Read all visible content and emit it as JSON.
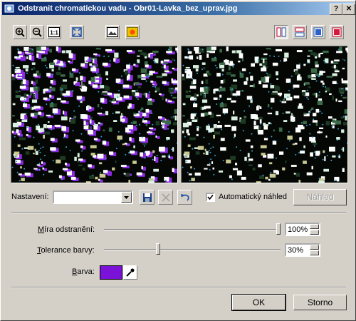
{
  "window": {
    "title": "Odstranit chromatickou vadu - Obr01-Lavka_bez_uprav.jpg",
    "help_label": "?",
    "close_label": "✕"
  },
  "toolbar_left": [
    {
      "icon": "zoom-in-icon"
    },
    {
      "icon": "zoom-out-icon"
    },
    {
      "icon": "actual-size-icon",
      "label": "1:1"
    },
    {
      "icon": "fit-window-icon"
    },
    {
      "icon": "image-icon"
    },
    {
      "icon": "sun-icon"
    }
  ],
  "toolbar_right": [
    {
      "icon": "split-vertical-icon",
      "pressed": true
    },
    {
      "icon": "split-horizontal-icon",
      "pressed": false
    },
    {
      "icon": "single-before-icon",
      "pressed": false
    },
    {
      "icon": "single-after-icon",
      "pressed": false
    }
  ],
  "settings": {
    "label": "Nastavení:",
    "preset_value": "",
    "auto_preview_label": "Automatický náhled",
    "auto_preview_checked": true,
    "preview_button": "Náhled"
  },
  "amount": {
    "label_accel": "M",
    "label_rest": "íra odstranění:",
    "value": "100%",
    "percent": 100
  },
  "tolerance": {
    "label_accel": "T",
    "label_rest": "olerance barvy:",
    "value": "30%",
    "percent": 30
  },
  "color": {
    "label_accel": "B",
    "label_rest": "arva:",
    "swatch": "#7a12d8"
  },
  "buttons": {
    "ok": "OK",
    "cancel": "Storno"
  },
  "colors": {
    "title_start": "#0a246a",
    "title_end": "#a6caf0",
    "face": "#d4d0c8",
    "fringe": "#8a2be2"
  }
}
